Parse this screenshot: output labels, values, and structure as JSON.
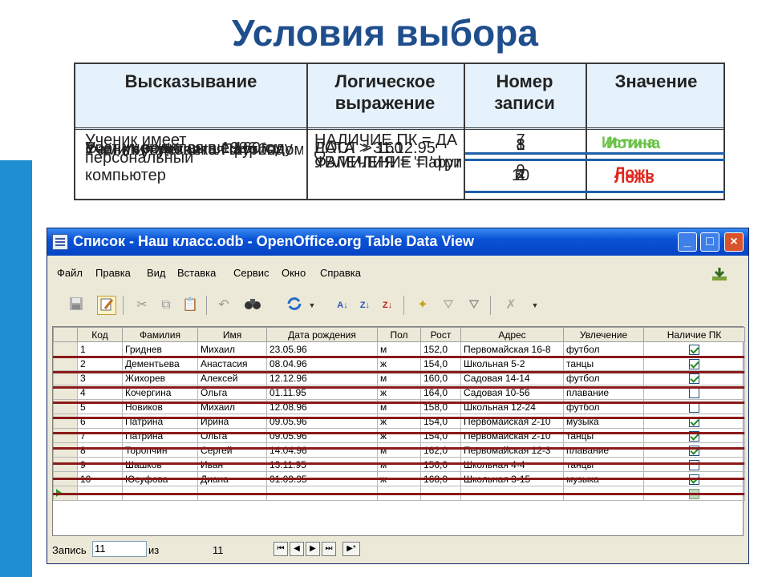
{
  "slide": {
    "title": "Условия выбора"
  },
  "logic_table": {
    "headers": [
      "Высказывание",
      "Логическое выражение",
      "Номер записи",
      "Значение"
    ],
    "statements": [
      "Ученик имеет персональный компьютер",
      "Рост ученика выше 160 см",
      "Ученик родился в 1996 году",
      "Фамилия ученика Патрина",
      "Ученик увлекается футболом"
    ],
    "expressions": [
      "НАЛИЧИЕ ПК = ДА",
      "РОСТ > 160",
      "ДАТА > 31.12.95",
      "ФАМИЛИЯ = 'Патрина'",
      "УВЛЕЧЕНИЕ = 'футбол'"
    ],
    "numbers_top": [
      "7",
      "8",
      "1",
      "3"
    ],
    "numbers_bottom": [
      "9",
      "10",
      "2",
      "4"
    ],
    "value_true": "Истина",
    "value_false": "Ложь"
  },
  "window": {
    "title": "Список - Наш класс.odb - OpenOffice.org Table Data View",
    "buttons": {
      "minimize": "_",
      "maximize": "□",
      "close": "×"
    },
    "menu": [
      "Файл",
      "Правка",
      "Вид",
      "Вставка",
      "Сервис",
      "Окно",
      "Справка"
    ],
    "toolbar_icons": [
      "save-icon",
      "edit-icon",
      "cut-icon",
      "copy-icon",
      "paste-icon",
      "undo-icon",
      "find-icon",
      "refresh-icon",
      "dropdown-icon",
      "sort-ascending-icon",
      "sort-descending-icon",
      "sort-icon",
      "autofilter-icon",
      "standard-filter-icon",
      "filter-icon",
      "remove-filter-icon",
      "more-icon"
    ]
  },
  "grid": {
    "columns": [
      "Код",
      "Фамилия",
      "Имя",
      "Дата рождения",
      "Пол",
      "Рост",
      "Адрес",
      "Увлечение",
      "Наличие ПК"
    ],
    "rows": [
      {
        "code": "1",
        "surname": "Гриднев",
        "name": "Михаил",
        "birth": "23.05.96",
        "sex": "м",
        "height": "152,0",
        "address": "Первомайская 16-8",
        "hobby": "футбол",
        "pc": true
      },
      {
        "code": "2",
        "surname": "Дементьева",
        "name": "Анастасия",
        "birth": "08.04.96",
        "sex": "ж",
        "height": "154,0",
        "address": "Школьная 5-2",
        "hobby": "танцы",
        "pc": true
      },
      {
        "code": "3",
        "surname": "Жихорев",
        "name": "Алексей",
        "birth": "12.12.96",
        "sex": "м",
        "height": "160,0",
        "address": "Садовая 14-14",
        "hobby": "футбол",
        "pc": true
      },
      {
        "code": "4",
        "surname": "Кочергина",
        "name": "Ольга",
        "birth": "01.11.95",
        "sex": "ж",
        "height": "164,0",
        "address": "Садовая 10-56",
        "hobby": "плавание",
        "pc": false
      },
      {
        "code": "5",
        "surname": "Новиков",
        "name": "Михаил",
        "birth": "12.08.96",
        "sex": "м",
        "height": "158,0",
        "address": "Школьная 12-24",
        "hobby": "футбол",
        "pc": false
      },
      {
        "code": "6",
        "surname": "Патрина",
        "name": "Ирина",
        "birth": "09.05.96",
        "sex": "ж",
        "height": "154,0",
        "address": "Первомайская 2-10",
        "hobby": "музыка",
        "pc": true
      },
      {
        "code": "7",
        "surname": "Патрина",
        "name": "Ольга",
        "birth": "09.05.96",
        "sex": "ж",
        "height": "154,0",
        "address": "Первомайская 2-10",
        "hobby": "танцы",
        "pc": true
      },
      {
        "code": "8",
        "surname": "Торопчин",
        "name": "Сергей",
        "birth": "14.04.96",
        "sex": "м",
        "height": "162,0",
        "address": "Первомайская 12-3",
        "hobby": "плавание",
        "pc": true
      },
      {
        "code": "9",
        "surname": "Шашков",
        "name": "Иван",
        "birth": "13.11.95",
        "sex": "м",
        "height": "156,0",
        "address": "Школьная 4-4",
        "hobby": "танцы",
        "pc": false
      },
      {
        "code": "10",
        "surname": "Юсуфова",
        "name": "Диана",
        "birth": "01.09.95",
        "sex": "ж",
        "height": "168,0",
        "address": "Школьная 3-15",
        "hobby": "музыка",
        "pc": true
      }
    ]
  },
  "status": {
    "record_label": "Запись",
    "record_value": "11",
    "of_label": "из",
    "total": "11",
    "nav": [
      "⏮",
      "◀",
      "▶",
      "⏭",
      "▶*"
    ]
  }
}
